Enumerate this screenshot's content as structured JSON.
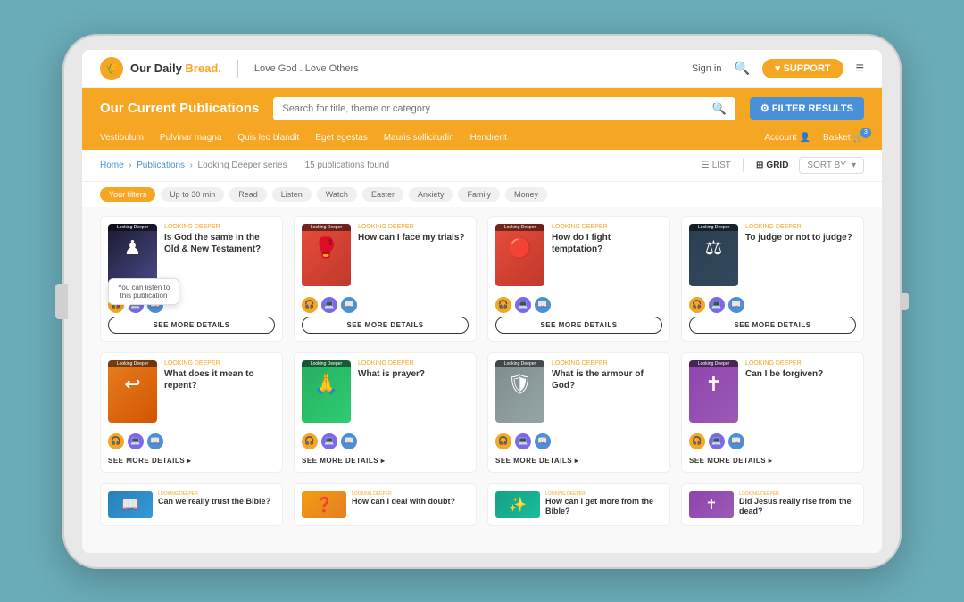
{
  "tablet": {
    "nav": {
      "logo_dot": "🌾",
      "logo_text": "Our Daily Bread.",
      "tagline": "Love God . Love Others",
      "sign_in": "Sign in",
      "support_label": "♥ SUPPORT",
      "hamburger": "≡"
    },
    "yellow_bar": {
      "title": "Our Current Publications",
      "search_placeholder": "Search for title, theme or category",
      "filter_label": "⚙ FILTER RESULTS"
    },
    "secondary_nav": {
      "items": [
        "Vestibulum",
        "Pulvinar magna",
        "Quis leo blandit",
        "Eget egestas",
        "Mauris sollicitudin",
        "Hendrerit"
      ],
      "account_label": "Account",
      "basket_label": "Basket",
      "basket_count": "3"
    },
    "breadcrumb": {
      "home": "Home",
      "publications": "Publications",
      "series": "Looking Deeper series"
    },
    "results": {
      "count": "15 publications found"
    },
    "view": {
      "list_label": "LIST",
      "grid_label": "GRID",
      "sort_label": "SORT BY"
    },
    "chips": [
      {
        "label": "Your filters",
        "active": true
      },
      {
        "label": "Up to 30 min",
        "active": false
      },
      {
        "label": "Read",
        "active": false
      },
      {
        "label": "Listen",
        "active": false
      },
      {
        "label": "Watch",
        "active": false
      },
      {
        "label": "Easter",
        "active": false
      },
      {
        "label": "Anxiety",
        "active": false
      },
      {
        "label": "Family",
        "active": false
      },
      {
        "label": "Money",
        "active": false
      }
    ],
    "cards_row1": [
      {
        "id": "card-1",
        "series": "Looking Deeper",
        "title": "Is God the same in the Old & New Testament?",
        "thumb_class": "thumb-chess",
        "thumb_emoji": "♟",
        "tooltip": "You can listen to this publication",
        "btn_label": "SEE MORE DETAILS",
        "btn_type": "outline"
      },
      {
        "id": "card-2",
        "series": "Looking Deeper",
        "title": "How can I face my trials?",
        "thumb_class": "thumb-boxing",
        "thumb_emoji": "🥊",
        "tooltip": null,
        "btn_label": "SEE MORE DETAILS",
        "btn_type": "outline"
      },
      {
        "id": "card-3",
        "series": "Looking Deeper",
        "title": "How do I fight temptation?",
        "thumb_class": "thumb-button",
        "thumb_emoji": "🔴",
        "tooltip": null,
        "btn_label": "SEE MORE DETAILS",
        "btn_type": "outline"
      },
      {
        "id": "card-4",
        "series": "Looking Deeper",
        "title": "To judge or not to judge?",
        "thumb_class": "thumb-judge",
        "thumb_emoji": "⚖",
        "tooltip": null,
        "btn_label": "SEE MORE DETAILS",
        "btn_type": "outline"
      }
    ],
    "cards_row2": [
      {
        "id": "card-5",
        "series": "Looking Deeper",
        "title": "What does it mean to repent?",
        "thumb_class": "thumb-repent",
        "thumb_emoji": "↩",
        "btn_label": "SEE MORE DETAILS",
        "btn_type": "link"
      },
      {
        "id": "card-6",
        "series": "Looking Deeper",
        "title": "What is prayer?",
        "thumb_class": "thumb-prayer",
        "thumb_emoji": "🙏",
        "btn_label": "SEE MORE DETAILS",
        "btn_type": "link"
      },
      {
        "id": "card-7",
        "series": "Looking Deeper",
        "title": "What is the armour of God?",
        "thumb_class": "thumb-armour",
        "thumb_emoji": "🛡",
        "btn_label": "SEE MORE DETAILS",
        "btn_type": "link"
      },
      {
        "id": "card-8",
        "series": "Looking Deeper",
        "title": "Can I be forgiven?",
        "thumb_class": "thumb-forgiven",
        "thumb_emoji": "✝",
        "btn_label": "SEE MORE DETAILS",
        "btn_type": "link"
      }
    ],
    "cards_row3": [
      {
        "id": "card-9",
        "title": "Can we really trust the Bible?",
        "thumb_class": "thumb-really",
        "thumb_emoji": "📖"
      },
      {
        "id": "card-10",
        "title": "How can I deal with doubt?",
        "thumb_class": "thumb-deal",
        "thumb_emoji": "❓"
      },
      {
        "id": "card-11",
        "title": "How can I get more from the Bible?",
        "thumb_class": "thumb-get",
        "thumb_emoji": "✨"
      },
      {
        "id": "card-12",
        "title": "Did Jesus really rise from the dead?",
        "thumb_class": "thumb-jesus",
        "thumb_emoji": "✝"
      }
    ],
    "icon_labels": {
      "headphones": "🎧",
      "laptop": "💻",
      "book": "📖"
    }
  }
}
